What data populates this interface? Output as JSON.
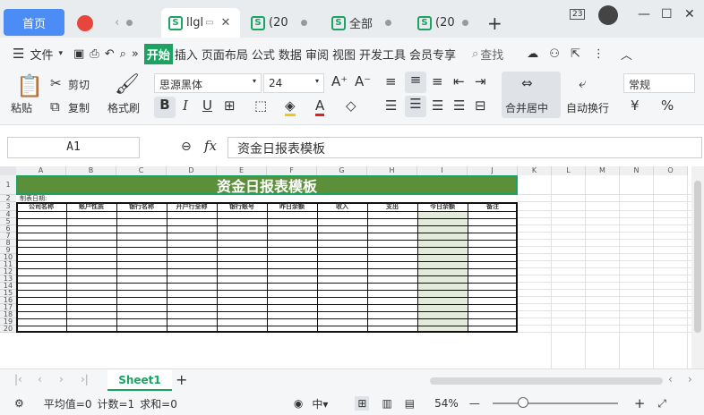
{
  "tabs": [
    {
      "label": "首页"
    },
    {
      "label": "llgl"
    },
    {
      "label": "(20"
    },
    {
      "label": "全部"
    },
    {
      "label": "(20"
    }
  ],
  "window": {
    "badge": "23"
  },
  "menu": {
    "file": "文件",
    "items": [
      "开始",
      "插入",
      "页面布局",
      "公式",
      "数据",
      "审阅",
      "视图",
      "开发工具",
      "会员专享"
    ],
    "search": "查找"
  },
  "ribbon": {
    "paste": "粘贴",
    "cut": "剪切",
    "copy": "复制",
    "format_painter": "格式刷",
    "font_name": "思源黑体",
    "font_size": "24",
    "merge_center": "合并居中",
    "wrap_text": "自动换行",
    "number_format": "常规",
    "currency": "¥",
    "percent": "%"
  },
  "formula_bar": {
    "cell_ref": "A1",
    "fx": "fx",
    "content": "资金日报表模板"
  },
  "sheet": {
    "columns": [
      "A",
      "B",
      "C",
      "D",
      "E",
      "F",
      "G",
      "H",
      "I",
      "J",
      "K",
      "L",
      "M",
      "N",
      "O"
    ],
    "rows": [
      "1",
      "2",
      "3",
      "4",
      "5",
      "6",
      "7",
      "8",
      "9",
      "10",
      "11",
      "12",
      "13",
      "14",
      "15",
      "16",
      "17",
      "18",
      "19",
      "20"
    ],
    "title": "资金日报表模板",
    "date_label": "制表日期:",
    "headers": [
      "公司名称",
      "账户性质",
      "银行名称",
      "开户行全称",
      "银行账号",
      "昨日余额",
      "收入",
      "支出",
      "今日余额",
      "备注"
    ]
  },
  "status": {
    "sheet_tab": "Sheet1",
    "average": "平均值=0",
    "count": "计数=1",
    "sum": "求和=0",
    "zoom": "54%"
  },
  "colors": {
    "title_bg": "#5b8f3a",
    "highlight_col": "#e2ecd8",
    "accent": "#1aa362",
    "home_tab": "#4b8cf5"
  }
}
